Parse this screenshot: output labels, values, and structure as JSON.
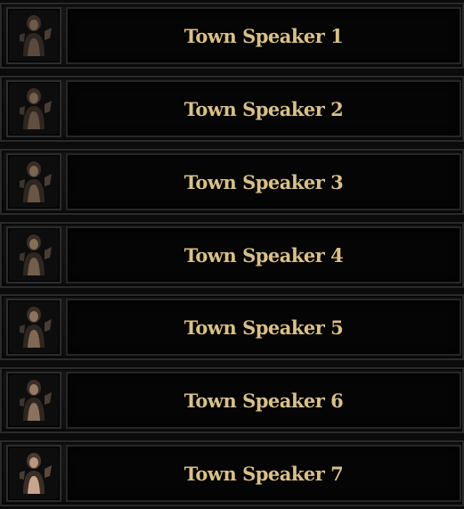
{
  "speakers": [
    {
      "name": "Town Speaker 1",
      "icon": "town-speaker-portrait-icon"
    },
    {
      "name": "Town Speaker 2",
      "icon": "town-speaker-portrait-icon"
    },
    {
      "name": "Town Speaker 3",
      "icon": "town-speaker-portrait-icon"
    },
    {
      "name": "Town Speaker 4",
      "icon": "town-speaker-portrait-icon"
    },
    {
      "name": "Town Speaker 5",
      "icon": "town-speaker-portrait-icon"
    },
    {
      "name": "Town Speaker 6",
      "icon": "town-speaker-portrait-icon"
    },
    {
      "name": "Town Speaker 7",
      "icon": "town-speaker-portrait-icon"
    }
  ],
  "colors": {
    "name_text": "#d9c08a",
    "panel_bg": "#050505",
    "frame_border": "#2a2a2a",
    "portrait_skin": "#a88a72",
    "portrait_dark": "#3a2e26"
  }
}
